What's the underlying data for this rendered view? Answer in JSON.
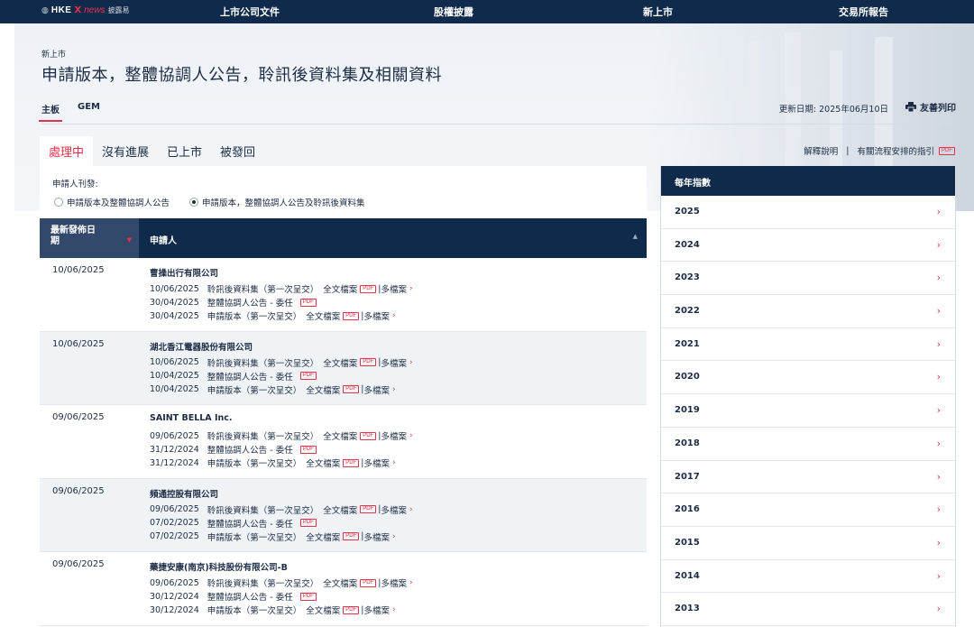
{
  "logo": {
    "hk": "HKE",
    "x": "X",
    "news": "news",
    "disclosure": "披露易"
  },
  "nav": [
    "上市公司文件",
    "股權披露",
    "新上市",
    "交易所報告"
  ],
  "breadcrumb": "新上市",
  "title": "申請版本，整體協調人公告，聆訊後資料集及相關資料",
  "board_tabs": [
    "主板",
    "GEM"
  ],
  "update_date": "更新日期: 2025年06月10日",
  "print_label": "友善列印",
  "status_tabs": [
    "處理中",
    "沒有進展",
    "已上市",
    "被發回"
  ],
  "links": {
    "explain": "解釋說明",
    "sep": "|",
    "guide": "有關流程安排的指引",
    "pdf": "PDF"
  },
  "filter": {
    "label": "申請人刊發:",
    "options": [
      "申請版本及整體協調人公告",
      "申請版本，整體協調人公告及聆訊後資料集"
    ],
    "selected": 1
  },
  "table": {
    "col_date": "最新發佈日期",
    "col_applicant": "申請人",
    "rows": [
      {
        "date": "10/06/2025",
        "name": "曹操出行有限公司",
        "lines": [
          {
            "date": "10/06/2025",
            "type": "聆訊後資料集（第一次呈交）",
            "full": "全文檔案",
            "multi": "多檔案"
          },
          {
            "date": "30/04/2025",
            "type": "整體協調人公告 - 委任",
            "full": "",
            "multi": ""
          },
          {
            "date": "30/04/2025",
            "type": "申請版本（第一次呈交）",
            "full": "全文檔案",
            "multi": "多檔案"
          }
        ]
      },
      {
        "date": "10/06/2025",
        "name": "湖北香江電器股份有限公司",
        "lines": [
          {
            "date": "10/06/2025",
            "type": "聆訊後資料集（第一次呈交）",
            "full": "全文檔案",
            "multi": "多檔案"
          },
          {
            "date": "10/04/2025",
            "type": "整體協調人公告 - 委任",
            "full": "",
            "multi": ""
          },
          {
            "date": "10/04/2025",
            "type": "申請版本（第一次呈交）",
            "full": "全文檔案",
            "multi": "多檔案"
          }
        ]
      },
      {
        "date": "09/06/2025",
        "name": "SAINT BELLA Inc.",
        "lines": [
          {
            "date": "09/06/2025",
            "type": "聆訊後資料集（第一次呈交）",
            "full": "全文檔案",
            "multi": "多檔案"
          },
          {
            "date": "31/12/2024",
            "type": "整體協調人公告 - 委任",
            "full": "",
            "multi": ""
          },
          {
            "date": "31/12/2024",
            "type": "申請版本（第一次呈交）",
            "full": "全文檔案",
            "multi": "多檔案"
          }
        ]
      },
      {
        "date": "09/06/2025",
        "name": "頻通控股有限公司",
        "lines": [
          {
            "date": "09/06/2025",
            "type": "聆訊後資料集（第一次呈交）",
            "full": "全文檔案",
            "multi": "多檔案"
          },
          {
            "date": "07/02/2025",
            "type": "整體協調人公告 - 委任",
            "full": "",
            "multi": ""
          },
          {
            "date": "07/02/2025",
            "type": "申請版本（第一次呈交）",
            "full": "全文檔案",
            "multi": "多檔案"
          }
        ]
      },
      {
        "date": "09/06/2025",
        "name": "藥捷安康(南京)科技股份有限公司-B",
        "lines": [
          {
            "date": "09/06/2025",
            "type": "聆訊後資料集（第一次呈交）",
            "full": "全文檔案",
            "multi": "多檔案"
          },
          {
            "date": "30/12/2024",
            "type": "整體協調人公告 - 委任",
            "full": "",
            "multi": ""
          },
          {
            "date": "30/12/2024",
            "type": "申請版本（第一次呈交）",
            "full": "全文檔案",
            "multi": "多檔案"
          }
        ]
      }
    ]
  },
  "pdf_badge": "PDF",
  "year_index": {
    "title": "每年指數",
    "years": [
      "2025",
      "2024",
      "2023",
      "2022",
      "2021",
      "2020",
      "2019",
      "2018",
      "2017",
      "2016",
      "2015",
      "2014",
      "2013"
    ]
  },
  "colors": {
    "navy": "#0f2a4a",
    "accent": "#e8324b",
    "header_date": "#33496b",
    "alt_row": "#f0f3f6"
  }
}
